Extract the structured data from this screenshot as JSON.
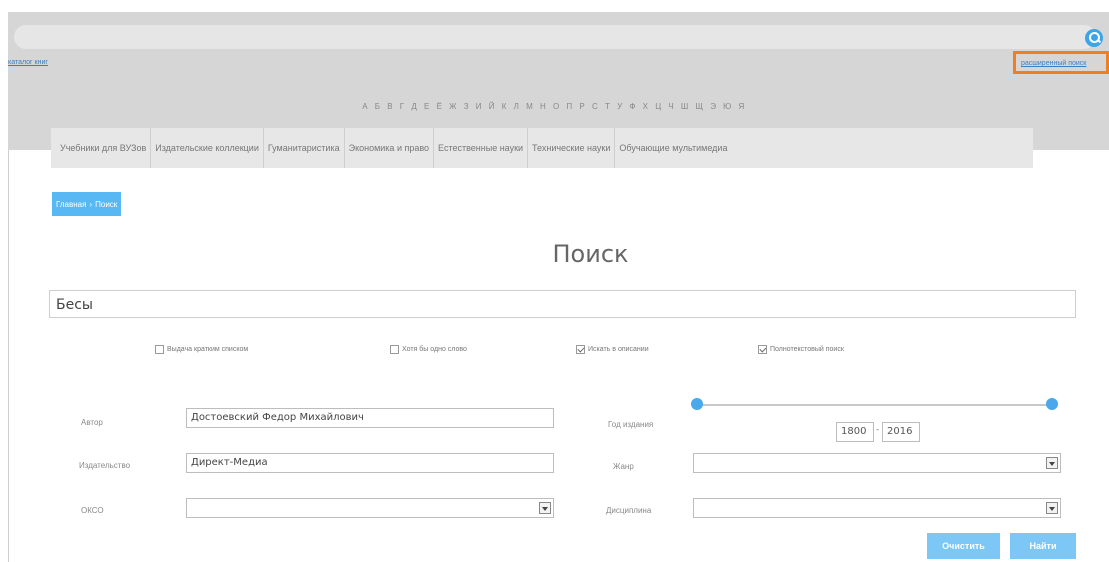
{
  "header": {
    "left_link": "каталог книг",
    "right_link": "расширенный поиск",
    "alphabet": "А Б В Г Д Е Ё Ж З И Й К Л М Н О П Р С Т У Ф Х Ц Ч Ш Щ Э Ю Я"
  },
  "categories": [
    "Учебники для ВУЗов",
    "Издательские коллекции",
    "Гуманитаристика",
    "Экономика и право",
    "Естественные науки",
    "Технические науки",
    "Обучающие мультимедиа"
  ],
  "breadcrumb": {
    "home": "Главная",
    "separator": "›",
    "current": "Поиск"
  },
  "page_title": "Поиск",
  "search": {
    "value": "Бесы"
  },
  "options": [
    {
      "label": "Выдача кратким списком",
      "checked": false
    },
    {
      "label": "Хотя бы одно слово",
      "checked": false
    },
    {
      "label": "Искать в описании",
      "checked": true
    },
    {
      "label": "Полнотекстовый поиск",
      "checked": true
    }
  ],
  "fields": {
    "author_label": "Автор",
    "author_value": "Достоевский Федор Михайлович",
    "publisher_label": "Издательство",
    "publisher_value": "Директ-Медиа",
    "okso_label": "ОКСО",
    "okso_value": "",
    "year_label": "Год издания",
    "year_from": "1800",
    "year_to": "2016",
    "year_sep": "-",
    "genre_label": "Жанр",
    "genre_value": "",
    "discipline_label": "Дисциплина",
    "discipline_value": ""
  },
  "buttons": {
    "clear": "Очистить",
    "find": "Найти"
  },
  "colors": {
    "accent": "#58b8f4",
    "highlight": "#f07f23"
  }
}
